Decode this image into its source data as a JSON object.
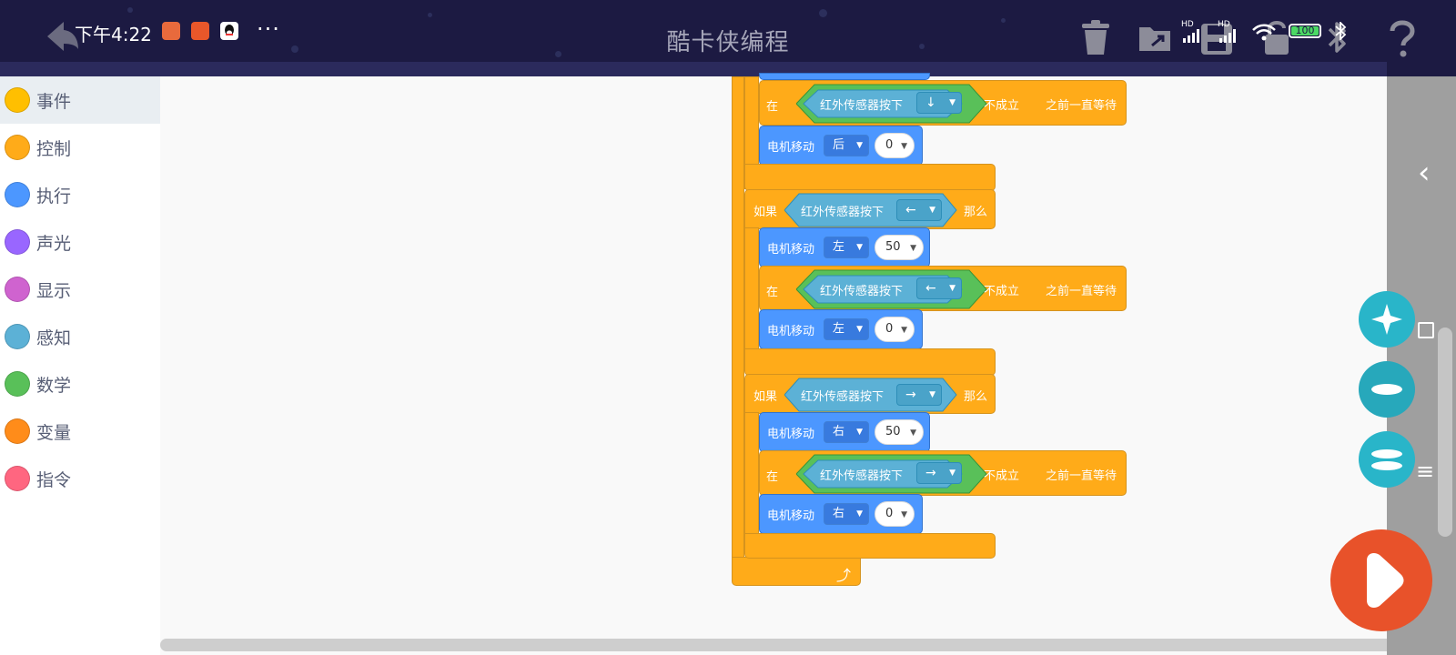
{
  "status_bar": {
    "time": "下午4:22",
    "more": "···",
    "battery": "100",
    "hd_1": "HD",
    "hd_2": "HD"
  },
  "app": {
    "title": "酷卡侠编程"
  },
  "toolbar": {
    "icons": [
      "delete-icon",
      "open-folder-icon",
      "save-icon",
      "lock-icon",
      "bluetooth-icon",
      "help-icon"
    ]
  },
  "categories": [
    {
      "label": "事件",
      "color": "#ffbf00"
    },
    {
      "label": "控制",
      "color": "#ffab19"
    },
    {
      "label": "执行",
      "color": "#4c97ff"
    },
    {
      "label": "声光",
      "color": "#9966ff"
    },
    {
      "label": "显示",
      "color": "#cf63cf"
    },
    {
      "label": "感知",
      "color": "#5cb1d6"
    },
    {
      "label": "数学",
      "color": "#59c059"
    },
    {
      "label": "变量",
      "color": "#ff8c1a"
    },
    {
      "label": "指令",
      "color": "#ff6680"
    }
  ],
  "blocks": {
    "if_label": "如果",
    "then_label": "那么",
    "wait_prefix": "在",
    "not_label": "不成立",
    "wait_suffix": "之前一直等待",
    "sensor_label": "红外传感器按下",
    "motor_label": "电机移动",
    "wait_1": {
      "arrow": "↓"
    },
    "motor_1": {
      "dir": "后",
      "speed": "0"
    },
    "if_2": {
      "arrow": "←"
    },
    "motor_2a": {
      "dir": "左",
      "speed": "50"
    },
    "wait_2": {
      "arrow": "←"
    },
    "motor_2b": {
      "dir": "左",
      "speed": "0"
    },
    "if_3": {
      "arrow": "→"
    },
    "motor_3a": {
      "dir": "右",
      "speed": "50"
    },
    "wait_3": {
      "arrow": "→"
    },
    "motor_3b": {
      "dir": "右",
      "speed": "0"
    },
    "loop_icon": "⤴"
  },
  "side_controls": {
    "back_arrow": "‹",
    "menu_icon": "≡"
  },
  "colors": {
    "control": "#ffab19",
    "motion": "#4c97ff",
    "sensing": "#5cb1d6",
    "operator": "#59c059",
    "accent": "#e8522a",
    "topbar": "#1c1a42"
  }
}
